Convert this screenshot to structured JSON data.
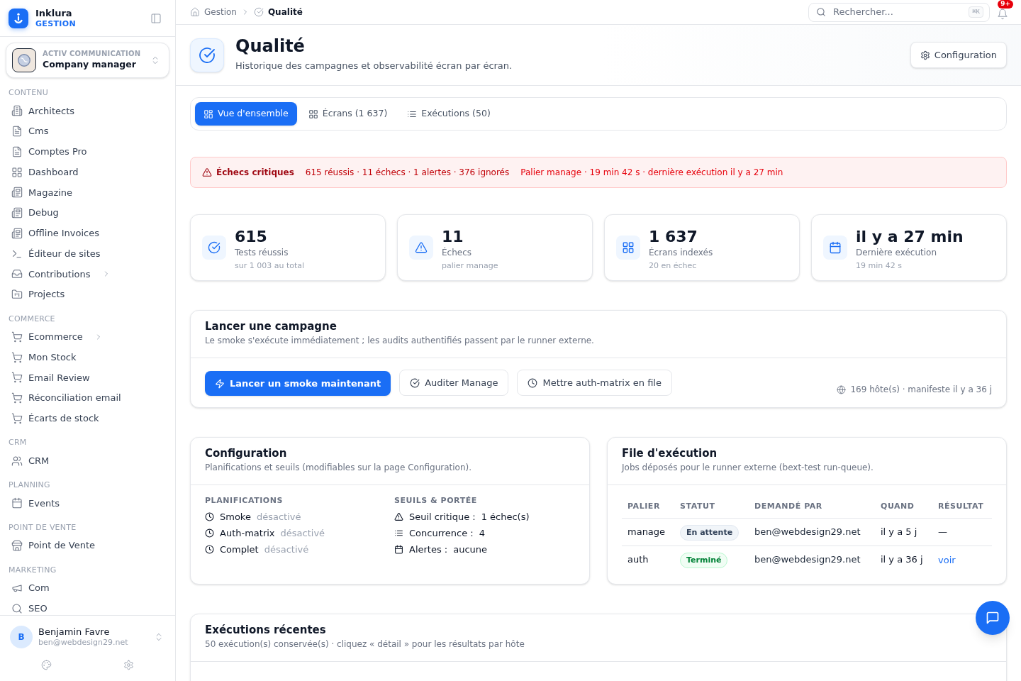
{
  "sidebar": {
    "brand": {
      "name": "Inklura",
      "tagline": "GESTION"
    },
    "workspace": {
      "organization": "ACTIV COMMUNICATION",
      "role": "Company manager"
    },
    "sections": [
      {
        "title": "CONTENU",
        "items": [
          {
            "label": "Architects",
            "submenu": false,
            "selected": false
          },
          {
            "label": "Cms",
            "submenu": false,
            "selected": false
          },
          {
            "label": "Comptes Pro",
            "submenu": false,
            "selected": false
          },
          {
            "label": "Dashboard",
            "submenu": false,
            "selected": false
          },
          {
            "label": "Magazine",
            "submenu": false,
            "selected": false
          },
          {
            "label": "Debug",
            "submenu": false,
            "selected": false
          },
          {
            "label": "Offline Invoices",
            "submenu": false,
            "selected": false
          },
          {
            "label": "Éditeur de sites",
            "submenu": false,
            "selected": false
          },
          {
            "label": "Contributions",
            "submenu": true,
            "selected": false
          },
          {
            "label": "Projects",
            "submenu": false,
            "selected": false
          }
        ]
      },
      {
        "title": "COMMERCE",
        "items": [
          {
            "label": "Ecommerce",
            "submenu": true,
            "selected": false
          },
          {
            "label": "Mon Stock",
            "submenu": false,
            "selected": false
          },
          {
            "label": "Email Review",
            "submenu": false,
            "selected": false
          },
          {
            "label": "Réconciliation email",
            "submenu": false,
            "selected": false
          },
          {
            "label": "Écarts de stock",
            "submenu": false,
            "selected": false
          }
        ]
      },
      {
        "title": "CRM",
        "items": [
          {
            "label": "CRM",
            "submenu": false,
            "selected": false
          }
        ]
      },
      {
        "title": "PLANNING",
        "items": [
          {
            "label": "Events",
            "submenu": false,
            "selected": false
          }
        ]
      },
      {
        "title": "POINT DE VENTE",
        "items": [
          {
            "label": "Point de Vente",
            "submenu": false,
            "selected": false
          }
        ]
      },
      {
        "title": "MARKETING",
        "items": [
          {
            "label": "Com",
            "submenu": false,
            "selected": false
          },
          {
            "label": "SEO",
            "submenu": false,
            "selected": false
          }
        ]
      }
    ],
    "user": {
      "initial": "B",
      "name": "Benjamin Favre",
      "email": "ben@webdesign29.net"
    }
  },
  "topbar": {
    "breadcrumb": [
      {
        "label": "Gestion",
        "current": false
      },
      {
        "label": "Qualité",
        "current": true
      }
    ],
    "search": {
      "placeholder": "Rechercher...",
      "shortcut": "⌘K"
    },
    "notifications": {
      "badge": "9+"
    }
  },
  "header": {
    "title": "Qualité",
    "subtitle": "Historique des campagnes et observabilité écran par écran.",
    "button": "Configuration"
  },
  "tabs": [
    {
      "label": "Vue d'ensemble",
      "selected": true
    },
    {
      "label": "Écrans (1 637)",
      "selected": false
    },
    {
      "label": "Exécutions (50)",
      "selected": false
    }
  ],
  "alert": {
    "title": "Échecs critiques",
    "summary": "615 réussis · 11 échecs · 1 alertes · 376 ignorés",
    "detail": "Palier manage · 19 min 42 s · dernière exécution il y a 27 min"
  },
  "stats": [
    {
      "value": "615",
      "label": "Tests réussis",
      "note": "sur 1 003 au total"
    },
    {
      "value": "11",
      "label": "Échecs",
      "note": "palier manage"
    },
    {
      "value": "1 637",
      "label": "Écrans indexés",
      "note": "20 en échec"
    },
    {
      "value": "il y a 27 min",
      "label": "Dernière exécution",
      "note": "19 min 42 s"
    }
  ],
  "campaign": {
    "title": "Lancer une campagne",
    "subtitle": "Le smoke s'exécute immédiatement ; les audits authentifiés passent par le runner externe.",
    "buttons": [
      {
        "label": "Lancer un smoke maintenant",
        "kind": "primary"
      },
      {
        "label": "Auditer Manage",
        "kind": "secondary"
      },
      {
        "label": "Mettre auth-matrix en file",
        "kind": "secondary"
      }
    ],
    "hosts": "169 hôte(s) · manifeste il y a 36 j"
  },
  "configuration": {
    "title": "Configuration",
    "subtitle": "Planifications et seuils (modifiables sur la page Configuration).",
    "schedules": {
      "title": "PLANIFICATIONS",
      "items": [
        {
          "name": "Smoke",
          "state": "désactivé"
        },
        {
          "name": "Auth-matrix",
          "state": "désactivé"
        },
        {
          "name": "Complet",
          "state": "désactivé"
        }
      ]
    },
    "thresholds": {
      "title": "SEUILS & PORTÉE",
      "items": [
        {
          "label": "Seuil critique :",
          "value": "1 échec(s)"
        },
        {
          "label": "Concurrence :",
          "value": "4"
        },
        {
          "label": "Alertes :",
          "value": "aucune"
        }
      ]
    }
  },
  "queue": {
    "title": "File d'exécution",
    "subtitle": "Jobs déposés pour le runner externe (bext-test run-queue).",
    "table": {
      "columns": [
        "PALIER",
        "STATUT",
        "DEMANDÉ PAR",
        "QUAND",
        "RÉSULTAT"
      ],
      "rows": [
        {
          "tier": "manage",
          "status": {
            "label": "En attente",
            "kind": "pending"
          },
          "requested_by": "ben@webdesign29.net",
          "when": "il y a 5 j",
          "result": {
            "text": "—",
            "kind": "text"
          }
        },
        {
          "tier": "auth",
          "status": {
            "label": "Terminé",
            "kind": "done"
          },
          "requested_by": "ben@webdesign29.net",
          "when": "il y a 36 j",
          "result": {
            "text": "voir",
            "kind": "link"
          }
        }
      ]
    }
  },
  "recent": {
    "title": "Exécutions récentes",
    "subtitle": "50 exécution(s) conservée(s) · cliquez « détail » pour les résultats par hôte"
  }
}
